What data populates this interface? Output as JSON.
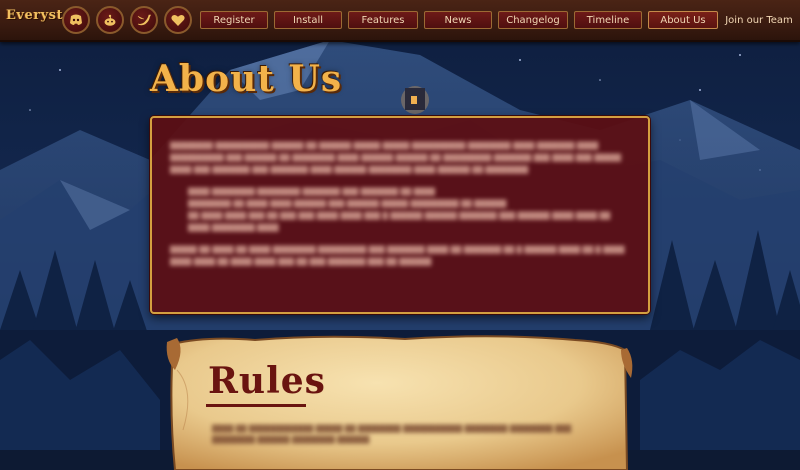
{
  "brand": {
    "logo": "Everyst"
  },
  "social": [
    {
      "name": "discord",
      "icon": "discord-icon"
    },
    {
      "name": "reddit",
      "icon": "reddit-icon"
    },
    {
      "name": "twitter",
      "icon": "twitter-icon"
    },
    {
      "name": "heart",
      "icon": "heart-icon"
    }
  ],
  "nav": {
    "register": "Register",
    "install": "Install",
    "features": "Features",
    "news": "News",
    "changelog": "Changelog",
    "timeline": "Timeline",
    "about": "About Us",
    "team": "Join our Team"
  },
  "about": {
    "title": "About Us"
  },
  "rules": {
    "title": "Rules"
  },
  "colors": {
    "topbar": "#3a1b10",
    "button": "#5a1410",
    "button_border": "#9c6a34",
    "accent_gold": "#f2b24a",
    "about_panel": "#5c0e12",
    "parchment": "#e9c98c",
    "rules_title": "#6a1410"
  }
}
